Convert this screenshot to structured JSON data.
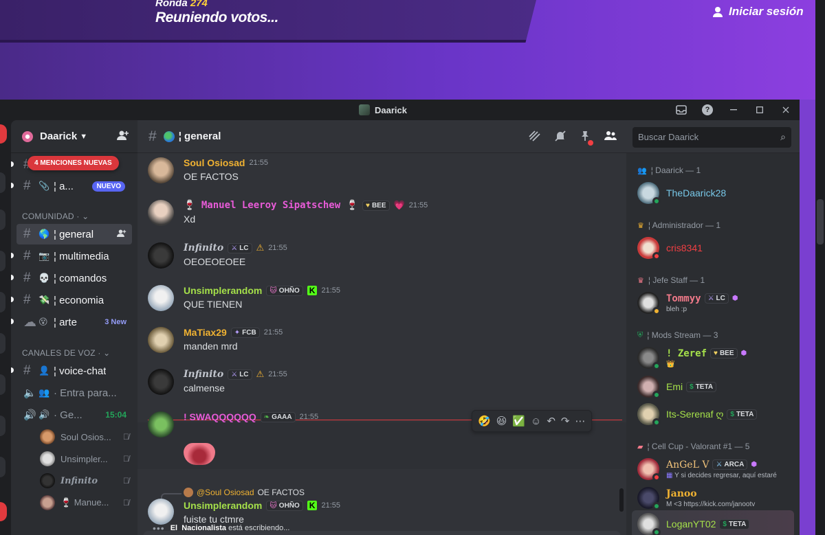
{
  "site": {
    "round_label": "Ronda ",
    "round_num": "274",
    "title": "Reuniendo votos...",
    "login": "Iniciar sesión"
  },
  "window": {
    "title": "Daarick",
    "help": "?"
  },
  "server": {
    "name": "Daarick"
  },
  "sidebar": {
    "mentions_pill": "4 MENCIONES NUEVAS",
    "channels_top": [
      {
        "emoji": "📎",
        "name": "¦ a...",
        "badge": "NUEVO"
      }
    ],
    "community_label": "COMUNIDAD ·",
    "community": [
      {
        "emoji": "🌎",
        "name": "¦ general"
      },
      {
        "emoji": "📷",
        "name": "¦ multimedia"
      },
      {
        "emoji": "💀",
        "name": "¦ comandos"
      },
      {
        "emoji": "💸",
        "name": "¦ economia"
      },
      {
        "emoji": "😵",
        "name": "¦ arte",
        "badge": "3 New"
      }
    ],
    "voice_label": "CANALES DE VOZ ·",
    "voice": [
      {
        "emoji": "👤",
        "name": "¦ voice-chat"
      },
      {
        "emoji": "👥",
        "name": "· Entra para..."
      },
      {
        "emoji": "🔊",
        "name": "· Ge...",
        "time": "15:04"
      }
    ],
    "voice_users": [
      {
        "name": "Soul Osios..."
      },
      {
        "name": "Unsimpler..."
      },
      {
        "name": "Infinito"
      },
      {
        "name": "🍷 Manue..."
      }
    ]
  },
  "chat": {
    "channel": "¦ general",
    "search_placeholder": "Buscar Daarick",
    "messages": [
      {
        "author": "Soul Osiosad",
        "color": "#f0b232",
        "time": "21:55",
        "text": "OE FACTOS"
      },
      {
        "author": "🍷 Manuel Leeroy Sipatschew 🍷",
        "color": "#e85bd8",
        "tag": "BEE",
        "time": "21:55",
        "text": "Xd"
      },
      {
        "author": "Infinito",
        "color": "#c0c4cc",
        "tag": "LC",
        "time": "21:55",
        "text": "OEOEOEOEE"
      },
      {
        "author": "Unsimplerandom",
        "color": "#a5e04a",
        "tag": "OHÑO",
        "time": "21:55",
        "text": "QUE TIENEN"
      },
      {
        "author": "MaTiax29",
        "color": "#f0b232",
        "tag": "FCB",
        "time": "21:55",
        "text": "manden mrd"
      },
      {
        "author": "Infinito",
        "color": "#c0c4cc",
        "tag": "LC",
        "time": "21:55",
        "text": "calmense"
      },
      {
        "author": "! SWAQQQQQQ",
        "color": "#e85bd8",
        "tag": "GAAA",
        "time": "21:55",
        "text": ""
      },
      {
        "author": "Unsimplerandom",
        "color": "#a5e04a",
        "tag": "OHÑO",
        "time": "21:55",
        "text": "fuiste tu ctmre"
      }
    ],
    "reply": {
      "user": "@Soul Osiosad",
      "text": "OE FACTOS"
    },
    "typing_user": "El_Nacionalista",
    "typing_text": "está escribiendo..."
  },
  "members": {
    "roles": [
      {
        "name": "¦ Daarick — 1"
      },
      {
        "name": "¦ Administrador — 1"
      },
      {
        "name": "¦ Jefe Staff — 1"
      },
      {
        "name": "¦ Mods Stream — 3"
      },
      {
        "name": "¦ Cell Cup - Valorant #1 — 5"
      }
    ],
    "list": [
      {
        "name": "TheDaarick28",
        "color": "#78c8e8",
        "status": "#23a55a"
      },
      {
        "name": "cris8341",
        "color": "#f23f43",
        "status": "#f23f43"
      },
      {
        "name": "Tommyy",
        "color": "#f27a8a",
        "tag": "LC",
        "sub": "bleh :p",
        "status": "#f0b232"
      },
      {
        "name": "! Zeref",
        "color": "#a5e04a",
        "tag": "BEE",
        "sub": "👑",
        "status": "#23a55a"
      },
      {
        "name": "Emi",
        "color": "#a5e04a",
        "tag": "TETA",
        "status": "#23a55a"
      },
      {
        "name": "Its-Serenaf ღ",
        "color": "#a5e04a",
        "tag": "TETA",
        "status": "#23a55a"
      },
      {
        "name": "AnGeL V",
        "color": "#f0c27a",
        "tag": "ARCA",
        "sub": "Y si decides regresar, aquí estaré",
        "status": "#f23f43"
      },
      {
        "name": "Janoo",
        "color": "#f0b232",
        "sub": "M <3 https://kick.com/janootv",
        "status": "#23a55a"
      },
      {
        "name": "LoganYT02",
        "color": "#a5e04a",
        "tag": "TETA",
        "status": "#23a55a"
      }
    ]
  }
}
